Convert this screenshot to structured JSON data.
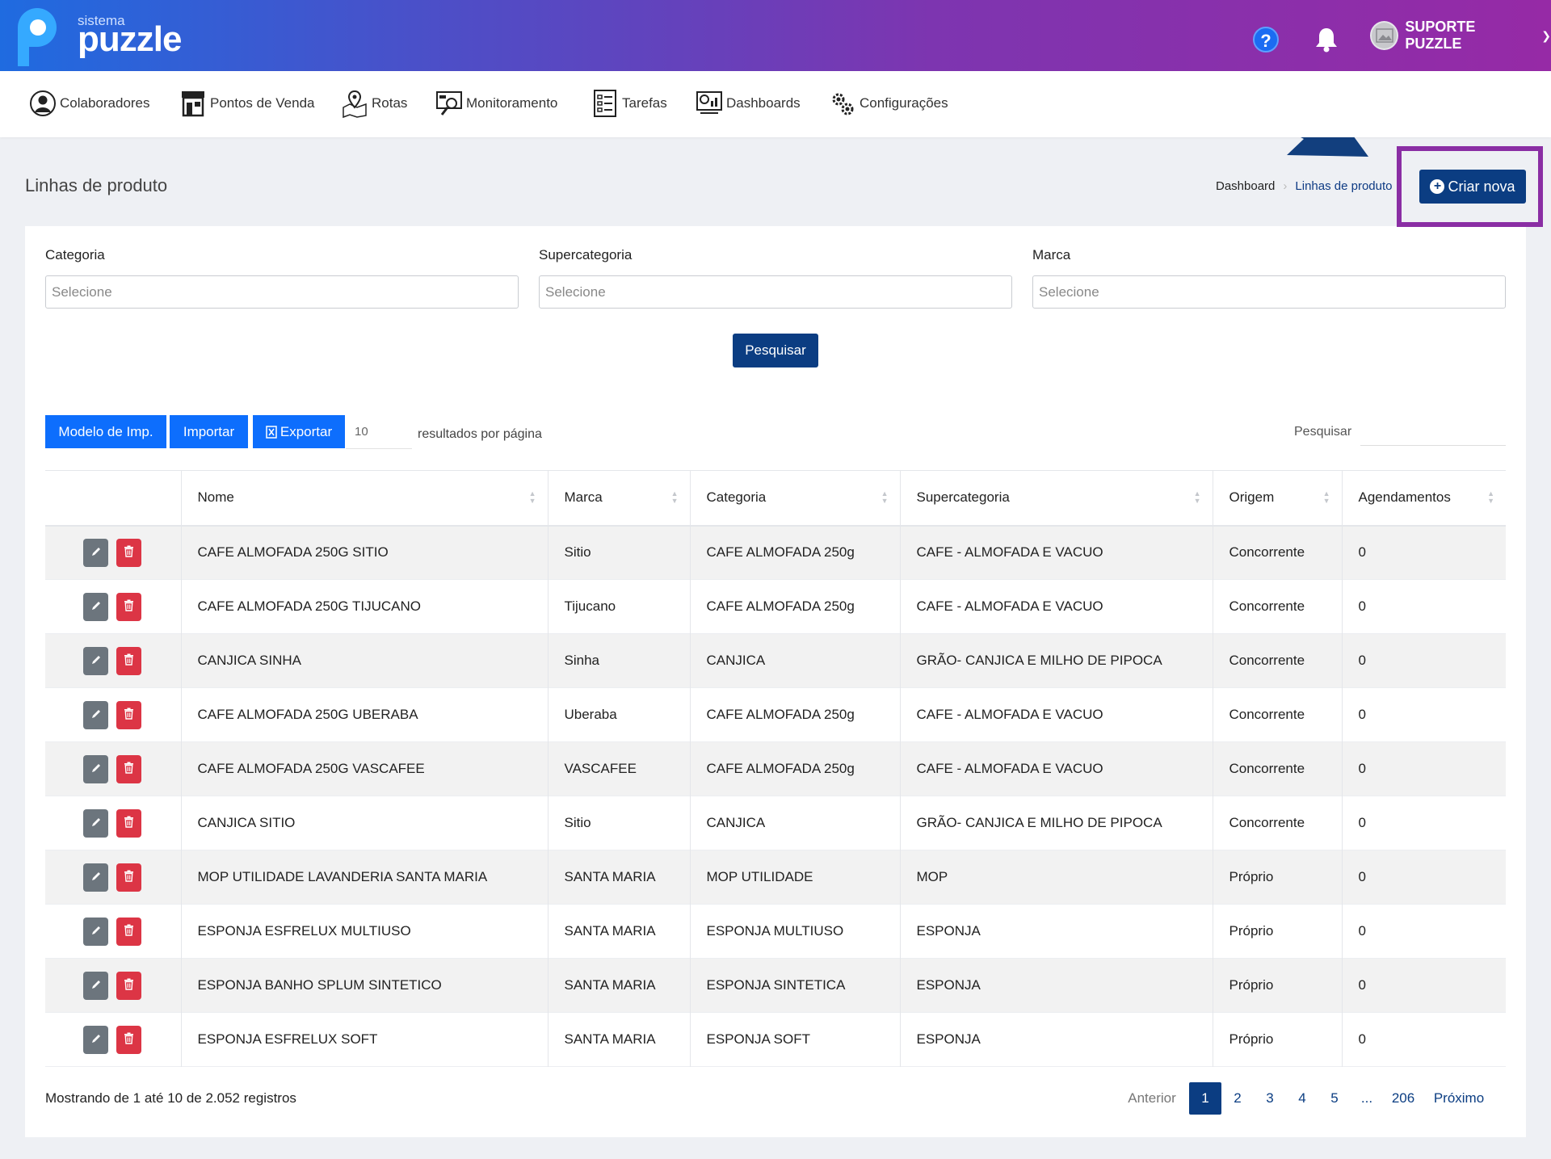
{
  "header": {
    "logo_small": "sistema",
    "logo_big": "puzzle",
    "help_label": "?",
    "user_name": "SUPORTE PUZZLE"
  },
  "nav": [
    {
      "label": "Colaboradores",
      "icon": "user-circle-icon"
    },
    {
      "label": "Pontos de Venda",
      "icon": "store-icon"
    },
    {
      "label": "Rotas",
      "icon": "map-pin-icon"
    },
    {
      "label": "Monitoramento",
      "icon": "monitor-search-icon"
    },
    {
      "label": "Tarefas",
      "icon": "checklist-icon"
    },
    {
      "label": "Dashboards",
      "icon": "dashboard-chart-icon"
    },
    {
      "label": "Configurações",
      "icon": "gears-icon"
    }
  ],
  "page": {
    "title": "Linhas de produto",
    "breadcrumb_home": "Dashboard",
    "breadcrumb_sep": "›",
    "breadcrumb_current": "Linhas de produto",
    "create_label": "Criar nova",
    "create_plus": "+"
  },
  "filters": {
    "categoria_label": "Categoria",
    "supercategoria_label": "Supercategoria",
    "marca_label": "Marca",
    "placeholder": "Selecione",
    "search_button": "Pesquisar"
  },
  "toolbar": {
    "modelo_label": "Modelo de Imp.",
    "importar_label": "Importar",
    "exportar_label": "Exportar",
    "per_page_value": "10",
    "per_page_label": "resultados por página",
    "search_label": "Pesquisar"
  },
  "table": {
    "columns": [
      "Nome",
      "Marca",
      "Categoria",
      "Supercategoria",
      "Origem",
      "Agendamentos"
    ],
    "rows": [
      [
        "CAFE ALMOFADA 250G SITIO",
        "Sitio",
        "CAFE ALMOFADA 250g",
        "CAFE - ALMOFADA E VACUO",
        "Concorrente",
        "0"
      ],
      [
        "CAFE ALMOFADA 250G TIJUCANO",
        "Tijucano",
        "CAFE ALMOFADA 250g",
        "CAFE - ALMOFADA E VACUO",
        "Concorrente",
        "0"
      ],
      [
        "CANJICA SINHA",
        "Sinha",
        "CANJICA",
        "GRÃO- CANJICA E MILHO DE PIPOCA",
        "Concorrente",
        "0"
      ],
      [
        "CAFE ALMOFADA 250G UBERABA",
        "Uberaba",
        "CAFE ALMOFADA 250g",
        "CAFE - ALMOFADA E VACUO",
        "Concorrente",
        "0"
      ],
      [
        "CAFE ALMOFADA 250G VASCAFEE",
        "VASCAFEE",
        "CAFE ALMOFADA 250g",
        "CAFE - ALMOFADA E VACUO",
        "Concorrente",
        "0"
      ],
      [
        "CANJICA SITIO",
        "Sitio",
        "CANJICA",
        "GRÃO- CANJICA E MILHO DE PIPOCA",
        "Concorrente",
        "0"
      ],
      [
        "MOP UTILIDADE LAVANDERIA SANTA MARIA",
        "SANTA MARIA",
        "MOP UTILIDADE",
        "MOP",
        "Próprio",
        "0"
      ],
      [
        "ESPONJA ESFRELUX MULTIUSO",
        "SANTA MARIA",
        "ESPONJA MULTIUSO",
        "ESPONJA",
        "Próprio",
        "0"
      ],
      [
        "ESPONJA BANHO SPLUM SINTETICO",
        "SANTA MARIA",
        "ESPONJA SINTETICA",
        "ESPONJA",
        "Próprio",
        "0"
      ],
      [
        "ESPONJA ESFRELUX SOFT",
        "SANTA MARIA",
        "ESPONJA SOFT",
        "ESPONJA",
        "Próprio",
        "0"
      ]
    ]
  },
  "footer": {
    "showing": "Mostrando de 1 até 10 de 2.052 registros",
    "prev": "Anterior",
    "pages": [
      "1",
      "2",
      "3",
      "4",
      "5",
      "...",
      "206"
    ],
    "next": "Próximo"
  },
  "colors": {
    "primary": "#0b3d82",
    "button_blue": "#0d6efd",
    "highlight": "#8a2ea4",
    "delete_red": "#dc3545"
  }
}
